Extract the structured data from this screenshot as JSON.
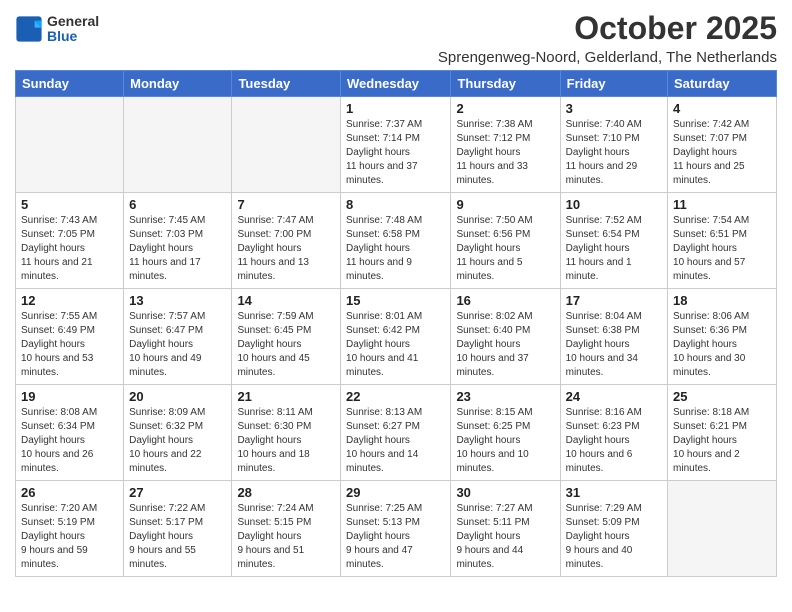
{
  "header": {
    "logo_general": "General",
    "logo_blue": "Blue",
    "month_title": "October 2025",
    "location": "Sprengenweg-Noord, Gelderland, The Netherlands"
  },
  "days_of_week": [
    "Sunday",
    "Monday",
    "Tuesday",
    "Wednesday",
    "Thursday",
    "Friday",
    "Saturday"
  ],
  "weeks": [
    [
      {
        "day": "",
        "empty": true
      },
      {
        "day": "",
        "empty": true
      },
      {
        "day": "",
        "empty": true
      },
      {
        "day": "1",
        "sunrise": "7:37 AM",
        "sunset": "7:14 PM",
        "daylight": "11 hours and 37 minutes."
      },
      {
        "day": "2",
        "sunrise": "7:38 AM",
        "sunset": "7:12 PM",
        "daylight": "11 hours and 33 minutes."
      },
      {
        "day": "3",
        "sunrise": "7:40 AM",
        "sunset": "7:10 PM",
        "daylight": "11 hours and 29 minutes."
      },
      {
        "day": "4",
        "sunrise": "7:42 AM",
        "sunset": "7:07 PM",
        "daylight": "11 hours and 25 minutes."
      }
    ],
    [
      {
        "day": "5",
        "sunrise": "7:43 AM",
        "sunset": "7:05 PM",
        "daylight": "11 hours and 21 minutes."
      },
      {
        "day": "6",
        "sunrise": "7:45 AM",
        "sunset": "7:03 PM",
        "daylight": "11 hours and 17 minutes."
      },
      {
        "day": "7",
        "sunrise": "7:47 AM",
        "sunset": "7:00 PM",
        "daylight": "11 hours and 13 minutes."
      },
      {
        "day": "8",
        "sunrise": "7:48 AM",
        "sunset": "6:58 PM",
        "daylight": "11 hours and 9 minutes."
      },
      {
        "day": "9",
        "sunrise": "7:50 AM",
        "sunset": "6:56 PM",
        "daylight": "11 hours and 5 minutes."
      },
      {
        "day": "10",
        "sunrise": "7:52 AM",
        "sunset": "6:54 PM",
        "daylight": "11 hours and 1 minute."
      },
      {
        "day": "11",
        "sunrise": "7:54 AM",
        "sunset": "6:51 PM",
        "daylight": "10 hours and 57 minutes."
      }
    ],
    [
      {
        "day": "12",
        "sunrise": "7:55 AM",
        "sunset": "6:49 PM",
        "daylight": "10 hours and 53 minutes."
      },
      {
        "day": "13",
        "sunrise": "7:57 AM",
        "sunset": "6:47 PM",
        "daylight": "10 hours and 49 minutes."
      },
      {
        "day": "14",
        "sunrise": "7:59 AM",
        "sunset": "6:45 PM",
        "daylight": "10 hours and 45 minutes."
      },
      {
        "day": "15",
        "sunrise": "8:01 AM",
        "sunset": "6:42 PM",
        "daylight": "10 hours and 41 minutes."
      },
      {
        "day": "16",
        "sunrise": "8:02 AM",
        "sunset": "6:40 PM",
        "daylight": "10 hours and 37 minutes."
      },
      {
        "day": "17",
        "sunrise": "8:04 AM",
        "sunset": "6:38 PM",
        "daylight": "10 hours and 34 minutes."
      },
      {
        "day": "18",
        "sunrise": "8:06 AM",
        "sunset": "6:36 PM",
        "daylight": "10 hours and 30 minutes."
      }
    ],
    [
      {
        "day": "19",
        "sunrise": "8:08 AM",
        "sunset": "6:34 PM",
        "daylight": "10 hours and 26 minutes."
      },
      {
        "day": "20",
        "sunrise": "8:09 AM",
        "sunset": "6:32 PM",
        "daylight": "10 hours and 22 minutes."
      },
      {
        "day": "21",
        "sunrise": "8:11 AM",
        "sunset": "6:30 PM",
        "daylight": "10 hours and 18 minutes."
      },
      {
        "day": "22",
        "sunrise": "8:13 AM",
        "sunset": "6:27 PM",
        "daylight": "10 hours and 14 minutes."
      },
      {
        "day": "23",
        "sunrise": "8:15 AM",
        "sunset": "6:25 PM",
        "daylight": "10 hours and 10 minutes."
      },
      {
        "day": "24",
        "sunrise": "8:16 AM",
        "sunset": "6:23 PM",
        "daylight": "10 hours and 6 minutes."
      },
      {
        "day": "25",
        "sunrise": "8:18 AM",
        "sunset": "6:21 PM",
        "daylight": "10 hours and 2 minutes."
      }
    ],
    [
      {
        "day": "26",
        "sunrise": "7:20 AM",
        "sunset": "5:19 PM",
        "daylight": "9 hours and 59 minutes."
      },
      {
        "day": "27",
        "sunrise": "7:22 AM",
        "sunset": "5:17 PM",
        "daylight": "9 hours and 55 minutes."
      },
      {
        "day": "28",
        "sunrise": "7:24 AM",
        "sunset": "5:15 PM",
        "daylight": "9 hours and 51 minutes."
      },
      {
        "day": "29",
        "sunrise": "7:25 AM",
        "sunset": "5:13 PM",
        "daylight": "9 hours and 47 minutes."
      },
      {
        "day": "30",
        "sunrise": "7:27 AM",
        "sunset": "5:11 PM",
        "daylight": "9 hours and 44 minutes."
      },
      {
        "day": "31",
        "sunrise": "7:29 AM",
        "sunset": "5:09 PM",
        "daylight": "9 hours and 40 minutes."
      },
      {
        "day": "",
        "empty": true
      }
    ]
  ]
}
